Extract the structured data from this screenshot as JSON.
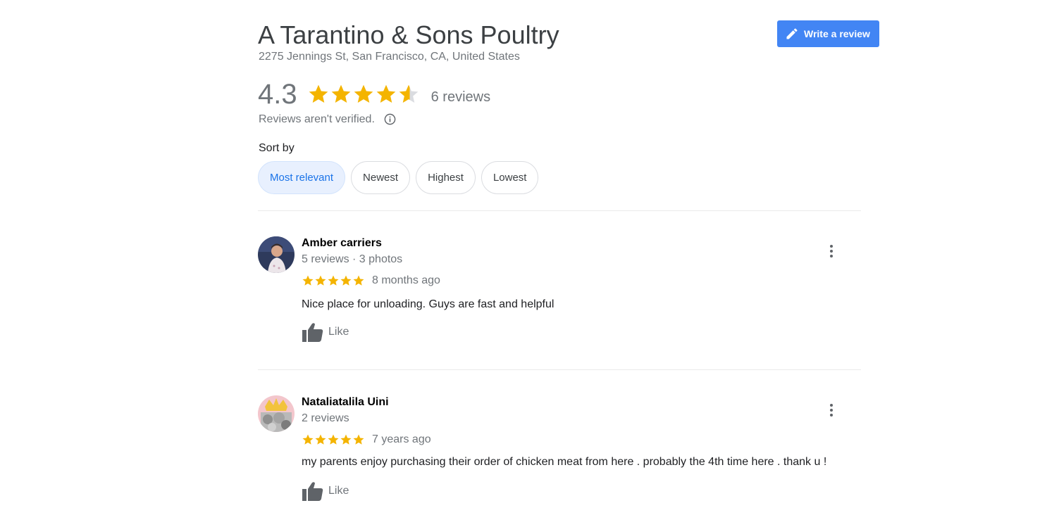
{
  "place": {
    "name": "A Tarantino & Sons Poultry",
    "address": "2275 Jennings St, San Francisco, CA, United States"
  },
  "write_review": {
    "label": "Write a review",
    "icon": "pencil-icon"
  },
  "summary": {
    "rating": "4.3",
    "rating_value": 4.3,
    "max_stars": 5,
    "reviews_count": "6 reviews",
    "verified_note": "Reviews aren't verified.",
    "info_icon": "info-icon"
  },
  "sort": {
    "label": "Sort by",
    "options": [
      "Most relevant",
      "Newest",
      "Highest",
      "Lowest"
    ],
    "selected": "Most relevant"
  },
  "reviews": [
    {
      "name": "Amber carriers",
      "meta": "5 reviews · 3 photos",
      "stars": 5,
      "date": "8 months ago",
      "text": "Nice place for unloading. Guys are fast and helpful",
      "like_label": "Like"
    },
    {
      "name": "Nataliatalila Uini",
      "meta": "2 reviews",
      "stars": 5,
      "date": "7 years ago",
      "text": "my parents enjoy purchasing their order of chicken meat from here . probably the 4th time here . thank u !",
      "like_label": "Like"
    }
  ],
  "colors": {
    "accent": "#4285f4",
    "star": "#f4b400",
    "star_empty": "#dadce0",
    "chip_active_bg": "#e8f0fe",
    "chip_active_text": "#1a73e8"
  }
}
